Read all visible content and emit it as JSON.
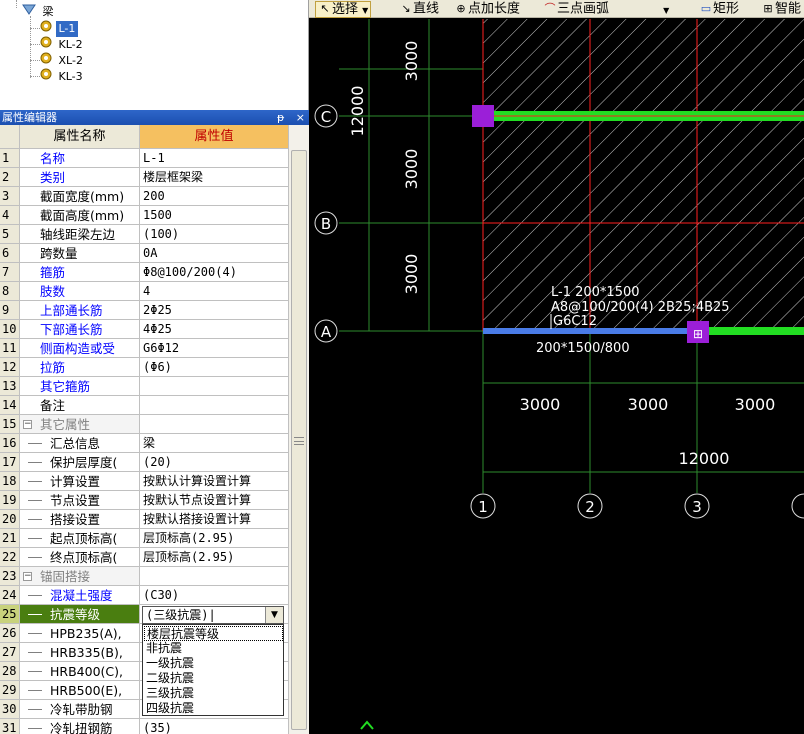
{
  "tree": {
    "root_label": "梁",
    "items": [
      "L-1",
      "KL-2",
      "XL-2",
      "KL-3"
    ],
    "selected_index": 0
  },
  "property_editor": {
    "title": "属性编辑器",
    "pin": "ᵽ",
    "close": "×",
    "col_name": "属性名称",
    "col_value": "属性值",
    "rows": [
      {
        "num": "1",
        "name": "名称",
        "value": "L-1",
        "style": "blue",
        "indent": 0
      },
      {
        "num": "2",
        "name": "类别",
        "value": "楼层框架梁",
        "style": "blue",
        "indent": 0
      },
      {
        "num": "3",
        "name": "截面宽度(mm)",
        "value": "200",
        "style": "black",
        "indent": 0
      },
      {
        "num": "4",
        "name": "截面高度(mm)",
        "value": "1500",
        "style": "black",
        "indent": 0
      },
      {
        "num": "5",
        "name": "轴线距梁左边",
        "value": "(100)",
        "style": "black",
        "indent": 0
      },
      {
        "num": "6",
        "name": "跨数量",
        "value": "0A",
        "style": "black",
        "indent": 0
      },
      {
        "num": "7",
        "name": "箍筋",
        "value": "Φ8@100/200(4)",
        "style": "blue",
        "indent": 0
      },
      {
        "num": "8",
        "name": "肢数",
        "value": "4",
        "style": "blue",
        "indent": 0
      },
      {
        "num": "9",
        "name": "上部通长筋",
        "value": "2Φ25",
        "style": "blue",
        "indent": 0
      },
      {
        "num": "10",
        "name": "下部通长筋",
        "value": "4Φ25",
        "style": "blue",
        "indent": 0
      },
      {
        "num": "11",
        "name": "侧面构造或受",
        "value": "G6Φ12",
        "style": "blue",
        "indent": 0
      },
      {
        "num": "12",
        "name": "拉筋",
        "value": "(Φ6)",
        "style": "blue",
        "indent": 0
      },
      {
        "num": "13",
        "name": "其它箍筋",
        "value": "",
        "style": "blue",
        "indent": 0
      },
      {
        "num": "14",
        "name": "备注",
        "value": "",
        "style": "black",
        "indent": 0
      },
      {
        "num": "15",
        "name": "其它属性",
        "value": "",
        "style": "gray",
        "indent": 0,
        "group": true
      },
      {
        "num": "16",
        "name": "汇总信息",
        "value": "梁",
        "style": "black",
        "indent": 1
      },
      {
        "num": "17",
        "name": "保护层厚度(",
        "value": "(20)",
        "style": "black",
        "indent": 1
      },
      {
        "num": "18",
        "name": "计算设置",
        "value": "按默认计算设置计算",
        "style": "black",
        "indent": 1
      },
      {
        "num": "19",
        "name": "节点设置",
        "value": "按默认节点设置计算",
        "style": "black",
        "indent": 1
      },
      {
        "num": "20",
        "name": "搭接设置",
        "value": "按默认搭接设置计算",
        "style": "black",
        "indent": 1
      },
      {
        "num": "21",
        "name": "起点顶标高(",
        "value": "层顶标高(2.95)",
        "style": "black",
        "indent": 1
      },
      {
        "num": "22",
        "name": "终点顶标高(",
        "value": "层顶标高(2.95)",
        "style": "black",
        "indent": 1
      },
      {
        "num": "23",
        "name": "锚固搭接",
        "value": "",
        "style": "gray",
        "indent": 0,
        "group": true
      },
      {
        "num": "24",
        "name": "混凝土强度",
        "value": "(C30)",
        "style": "blue",
        "indent": 1
      },
      {
        "num": "25",
        "name": "抗震等级",
        "value": "",
        "style": "white",
        "indent": 1,
        "active": true
      },
      {
        "num": "26",
        "name": "HPB235(A),",
        "value": "",
        "style": "black",
        "indent": 1
      },
      {
        "num": "27",
        "name": "HRB335(B),",
        "value": "",
        "style": "black",
        "indent": 1
      },
      {
        "num": "28",
        "name": "HRB400(C),",
        "value": "",
        "style": "black",
        "indent": 1
      },
      {
        "num": "29",
        "name": "HRB500(E),",
        "value": "",
        "style": "black",
        "indent": 1
      },
      {
        "num": "30",
        "name": "冷轧带肋钢",
        "value": "",
        "style": "black",
        "indent": 1
      },
      {
        "num": "31",
        "name": "冷轧扭钢筋",
        "value": "(35)",
        "style": "black",
        "indent": 1
      }
    ],
    "combo_value": "(三级抗震)|",
    "combo_arrow": "▼",
    "dropdown_options": [
      "楼层抗震等级",
      "非抗震",
      "一级抗震",
      "二级抗震",
      "三级抗震",
      "四级抗震"
    ],
    "dropdown_highlight": 0
  },
  "toolbar": {
    "select": "选择",
    "line": "直线",
    "point_length": "点加长度",
    "arc": "三点画弧",
    "rect": "矩形",
    "smart": "智能"
  },
  "canvas": {
    "left_dims": [
      "3000",
      "3000",
      "3000"
    ],
    "left_total": "12000",
    "bottom_dims": [
      "3000",
      "3000",
      "3000"
    ],
    "bottom_total": "12000",
    "axes_rows": [
      "C",
      "B",
      "A"
    ],
    "axes_cols": [
      "1",
      "2",
      "3"
    ],
    "beam_label_1": "L-1 200*1500",
    "beam_label_2": "A8@100/200(4) 2B25;4B25",
    "beam_label_3": "G6C12",
    "beam_section": "200*1500/800",
    "colors": {
      "grid": "#2e8b2e",
      "red": "#ff2020",
      "beam": "#22dd22",
      "selected": "#4a7ce8",
      "node": "#9b1fd8"
    }
  }
}
